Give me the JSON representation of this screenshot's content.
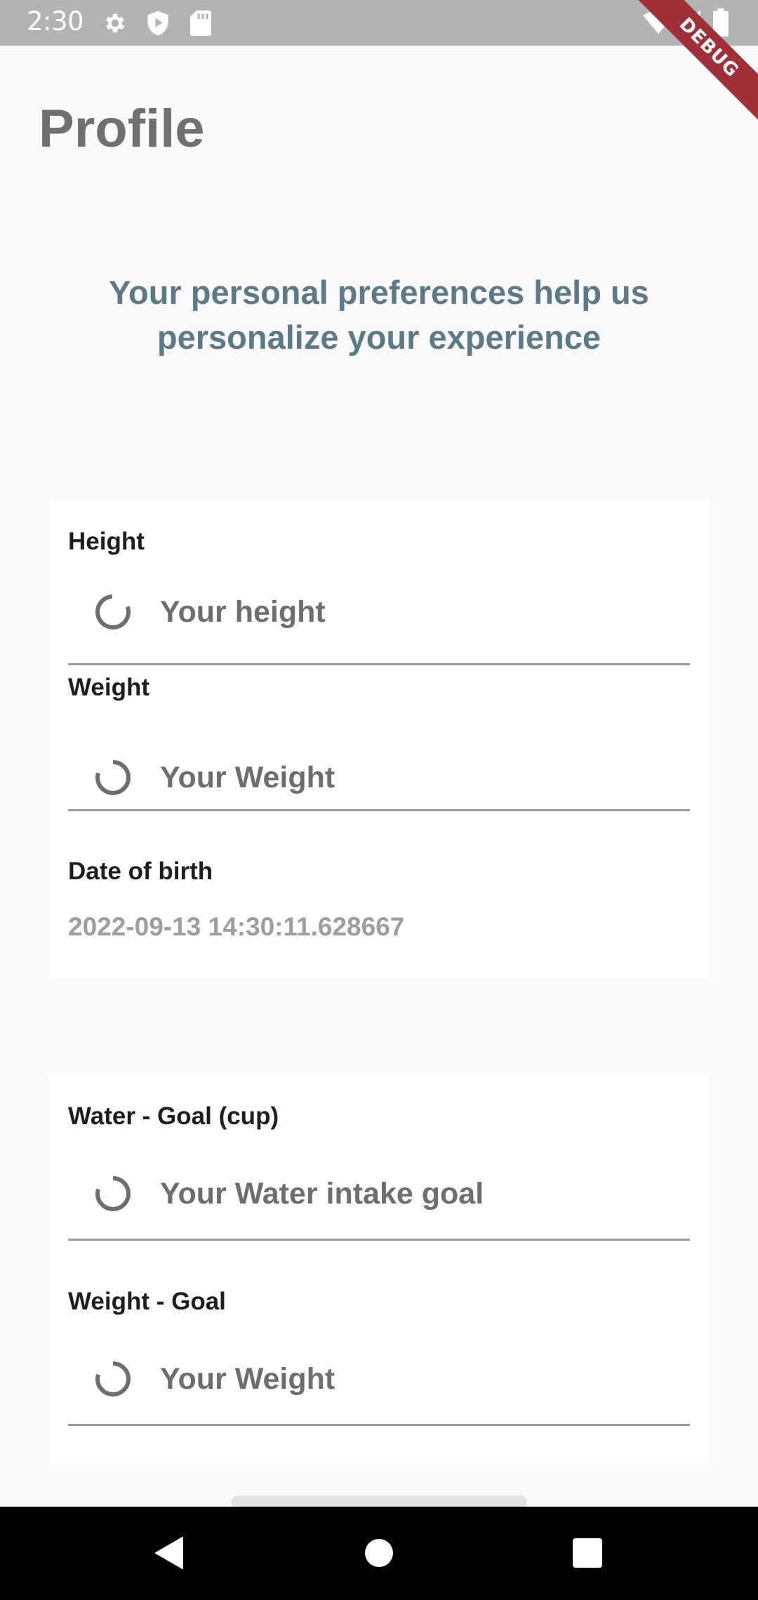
{
  "status_bar": {
    "time": "2:30",
    "left_icons": [
      "gear-icon",
      "shield-play-icon",
      "sd-card-icon"
    ],
    "right_icons": [
      "wifi-icon",
      "signal-icon",
      "battery-icon"
    ],
    "debug_banner": "DEBUG"
  },
  "header": {
    "title": "Profile",
    "intro": "Your personal preferences help us personalize your experience"
  },
  "personal_card": {
    "height": {
      "label": "Height",
      "placeholder": "Your height"
    },
    "weight": {
      "label": "Weight",
      "placeholder": "Your Weight"
    },
    "dob": {
      "label": "Date of birth",
      "value": "2022-09-13 14:30:11.628667"
    }
  },
  "goals_card": {
    "water_goal": {
      "label": "Water - Goal (cup)",
      "placeholder": "Your Water intake goal"
    },
    "weight_goal": {
      "label": "Weight - Goal",
      "placeholder": "Your Weight"
    }
  },
  "nav_bar": {
    "buttons": [
      "back-icon",
      "home-icon",
      "recents-icon"
    ]
  },
  "colors": {
    "status_bar": "#b3b3b3",
    "title": "#707070",
    "intro": "#5a7a8a",
    "debug": "#a02f38",
    "card": "#ffffff",
    "background": "#fafafa"
  }
}
